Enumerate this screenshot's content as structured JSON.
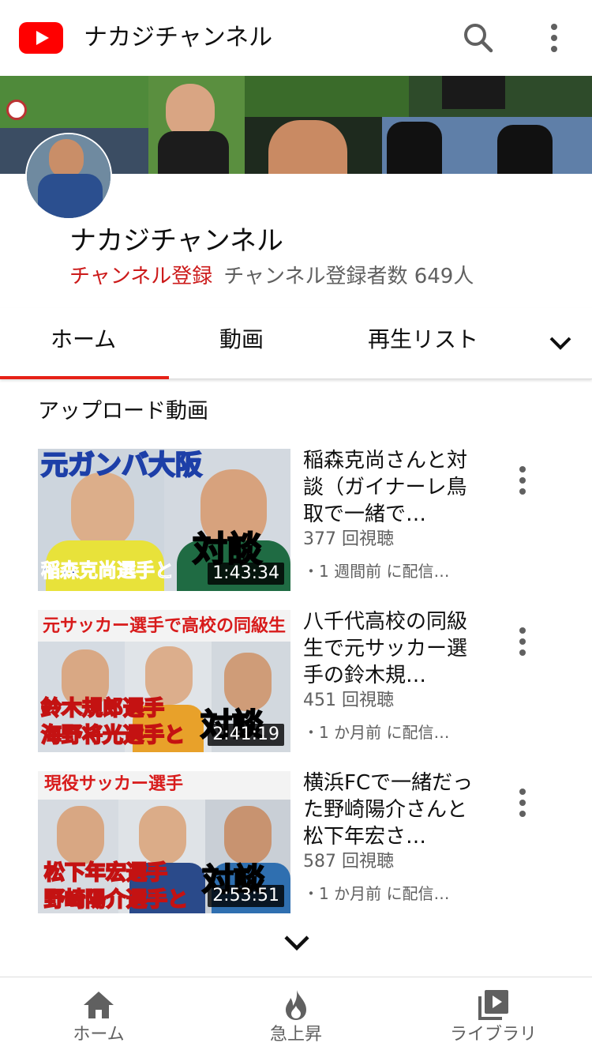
{
  "app": {
    "title": "ナカジチャンネル",
    "brand_color": "#ff0000",
    "icons": [
      "youtube-logo",
      "search-icon",
      "more-vert-icon"
    ]
  },
  "channel": {
    "name": "ナカジチャンネル",
    "subscribe_label": "チャンネル登録",
    "subscriber_count": "チャンネル登録者数 649人"
  },
  "tabs": [
    {
      "label": "ホーム",
      "selected": true
    },
    {
      "label": "動画",
      "selected": false
    },
    {
      "label": "再生リスト",
      "selected": false
    }
  ],
  "section": {
    "title": "アップロード動画"
  },
  "videos": [
    {
      "title": "稲森克尚さんと対談（ガイナーレ鳥取で一緒で…",
      "views": "377 回視聴",
      "date": "・1 週間前 に配信…",
      "duration": "1:43:34",
      "thumb_text_top": "元ガンバ大阪",
      "thumb_text_bottom": "稲森克尚選手と",
      "thumb_text_big": "対談"
    },
    {
      "title": "八千代高校の同級生で元サッカー選手の鈴木規…",
      "views": "451 回視聴",
      "date": "・1 か月前 に配信…",
      "duration": "2:41:19",
      "thumb_text_top": "元サッカー選手で高校の同級生",
      "thumb_text_line1": "鈴木規郎選手",
      "thumb_text_line2": "海野将光選手と",
      "thumb_text_big": "対談"
    },
    {
      "title": "横浜FCで一緒だった野崎陽介さんと松下年宏さ…",
      "views": "587 回視聴",
      "date": "・1 か月前 に配信…",
      "duration": "2:53:51",
      "thumb_text_top": "現役サッカー選手",
      "thumb_text_line1": "松下年宏選手",
      "thumb_text_line2": "野崎陽介選手と",
      "thumb_text_big": "対談"
    }
  ],
  "bottom_nav": [
    {
      "label": "ホーム",
      "icon": "home-icon"
    },
    {
      "label": "急上昇",
      "icon": "trending-fire-icon"
    },
    {
      "label": "ライブラリ",
      "icon": "library-icon"
    }
  ]
}
